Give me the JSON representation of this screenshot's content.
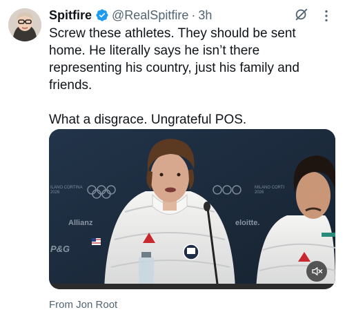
{
  "tweet": {
    "display_name": "Spitfire",
    "handle": "@RealSpitfire",
    "separator": "·",
    "time": "3h",
    "text": "Screw these athletes. They should be sent home. He literally says he isn’t there representing his country, just his family and friends.\n\nWhat a disgrace. Ungrateful POS."
  },
  "media": {
    "backdrop_text_left": "ILANO CORTINA\n2026",
    "backdrop_text_right": "MILANO CORTI\n2026",
    "sponsor_left": "Allianz",
    "sponsor_right": "eloitte.",
    "sponsor_pg": "P&G",
    "mute_icon": "volume-muted-icon"
  },
  "attribution": "From Jon Root",
  "colors": {
    "text_primary": "#0f1419",
    "text_secondary": "#536471",
    "verified_blue": "#1d9bf0"
  }
}
